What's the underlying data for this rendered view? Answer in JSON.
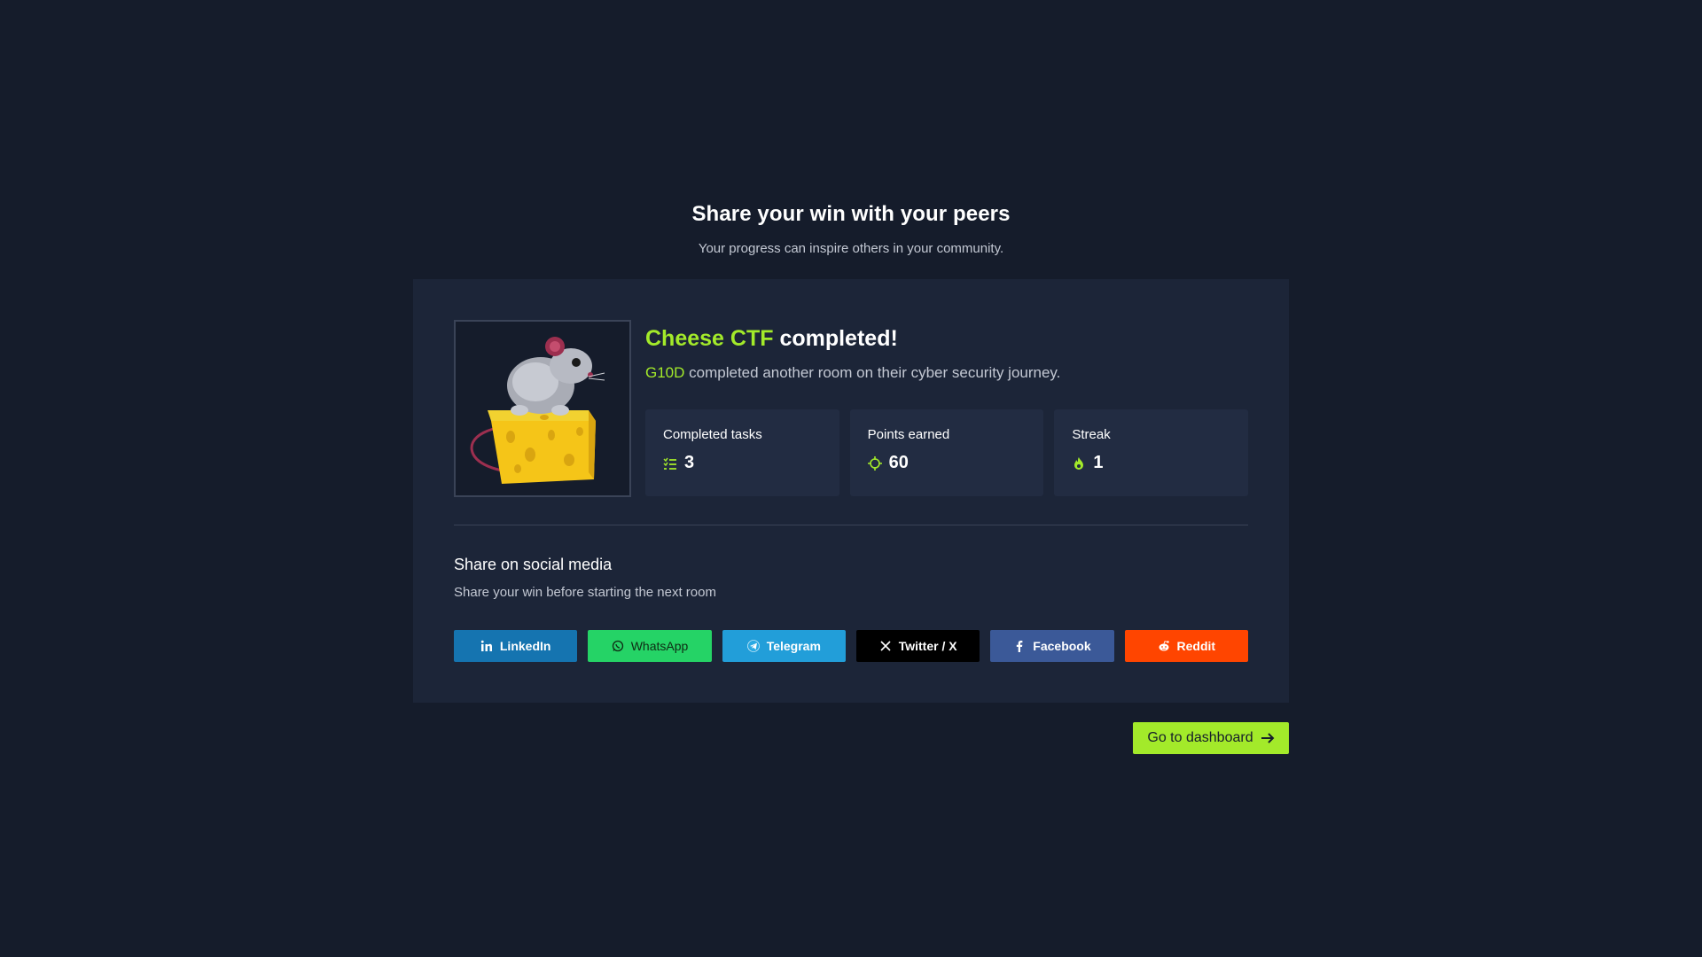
{
  "header": {
    "title": "Share your win with your peers",
    "subtitle": "Your progress can inspire others in your community."
  },
  "room": {
    "name": "Cheese CTF",
    "title_suffix": "completed!",
    "username": "G10D",
    "description": "completed another room on their cyber security journey."
  },
  "stats": [
    {
      "label": "Completed tasks",
      "value": "3",
      "icon": "task-list-icon"
    },
    {
      "label": "Points earned",
      "value": "60",
      "icon": "crosshair-icon"
    },
    {
      "label": "Streak",
      "value": "1",
      "icon": "fire-icon"
    }
  ],
  "share": {
    "title": "Share on social media",
    "subtitle": "Share your win before starting the next room",
    "buttons": [
      {
        "label": "LinkedIn",
        "icon": "linkedin-icon",
        "color": "#1574b0"
      },
      {
        "label": "WhatsApp",
        "icon": "whatsapp-icon",
        "color": "#25d366"
      },
      {
        "label": "Telegram",
        "icon": "telegram-icon",
        "color": "#229ed9"
      },
      {
        "label": "Twitter / X",
        "icon": "x-icon",
        "color": "#000000"
      },
      {
        "label": "Facebook",
        "icon": "facebook-icon",
        "color": "#3b5998"
      },
      {
        "label": "Reddit",
        "icon": "reddit-icon",
        "color": "#ff4500"
      }
    ]
  },
  "actions": {
    "dashboard_label": "Go to dashboard"
  },
  "colors": {
    "background": "#151c2b",
    "card": "#1c2538",
    "accent": "#a3ea2a"
  }
}
